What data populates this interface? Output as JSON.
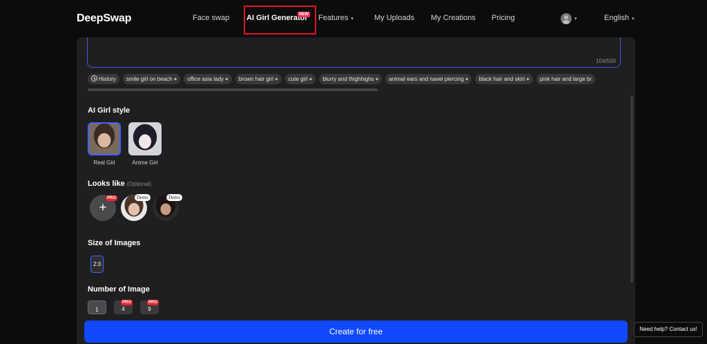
{
  "header": {
    "logo": "DeepSwap",
    "nav": {
      "face_swap": "Face swap",
      "ai_girl": "AI Girl Generator",
      "new_badge": "NEW",
      "features": "Features",
      "uploads": "My Uploads",
      "creations": "My Creations",
      "pricing": "Pricing",
      "language": "English"
    }
  },
  "prompt": {
    "char_count": "104/500"
  },
  "chips": {
    "history": "History",
    "items": [
      "smile girl on beach",
      "office asia lady",
      "brown hair girl",
      "cute girl",
      "blurry and thighhighs",
      "animal ears and navel piercing",
      "black hair and skirt",
      "pink hair and large br"
    ]
  },
  "style": {
    "title": "AI Girl style",
    "options": [
      "Real Girl",
      "Anime Girl"
    ]
  },
  "looks": {
    "title": "Looks like",
    "optional": "(Optional)",
    "pro": "PRO",
    "demo": "Demo"
  },
  "size": {
    "title": "Size of Images",
    "value": "2:3"
  },
  "number": {
    "title": "Number of Image",
    "options": [
      "1",
      "4",
      "9"
    ],
    "pro": "PRO"
  },
  "create_label": "Create for free",
  "help_label": "Need help? Contact us!",
  "colors": {
    "accent": "#0f48ff",
    "highlight": "#e0161f",
    "pro": "#e5242c"
  }
}
